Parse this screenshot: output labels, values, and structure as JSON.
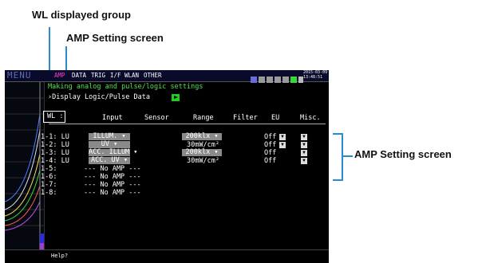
{
  "annotations": {
    "wl_group": "WL displayed group",
    "amp_top": "AMP Setting screen",
    "amp_right": "AMP Setting screen"
  },
  "colors": {
    "annot_line": "#2a8ccf",
    "active_tab": "#ff3bd1",
    "title_text": "#4fe34f",
    "play_button": "#1fd11f"
  },
  "screen": {
    "menu": "MENU",
    "tabs": [
      "AMP",
      "DATA",
      "TRIG",
      "I/F",
      "WLAN",
      "OTHER"
    ],
    "date": "2015-03-09",
    "time": "13:48:51",
    "title": "Making analog and pulse/logic settings",
    "display_logic": "›Display Logic/Pulse Data",
    "headers": {
      "wl": "WL :",
      "input": "Input",
      "sensor": "Sensor",
      "range": "Range",
      "filter": "Filter",
      "eu": "EU",
      "misc": "Misc."
    },
    "rows": [
      {
        "ch": "1-1: LU",
        "input": "ILLUM.",
        "range": "200klx",
        "eu": "Off",
        "eu_arrow": true,
        "misc": true
      },
      {
        "ch": "1-2: LU",
        "input": "UV",
        "range": "30mW/cm²",
        "eu": "Off",
        "eu_arrow": true,
        "misc": true
      },
      {
        "ch": "1-3: LU",
        "input": "ACC. ILLUM",
        "range": "200klx",
        "eu": "Off",
        "eu_arrow": false,
        "misc": true
      },
      {
        "ch": "1-4: LU",
        "input": "ACC. UV",
        "range": "30mW/cm²",
        "eu": "Off",
        "eu_arrow": false,
        "misc": true
      },
      {
        "ch": "1-5:",
        "noamp": "--- No AMP ---"
      },
      {
        "ch": "1-6:",
        "noamp": "--- No AMP ---"
      },
      {
        "ch": "1-7:",
        "noamp": "--- No AMP ---"
      },
      {
        "ch": "1-8:",
        "noamp": "--- No AMP ---"
      }
    ],
    "help": "Help?"
  }
}
